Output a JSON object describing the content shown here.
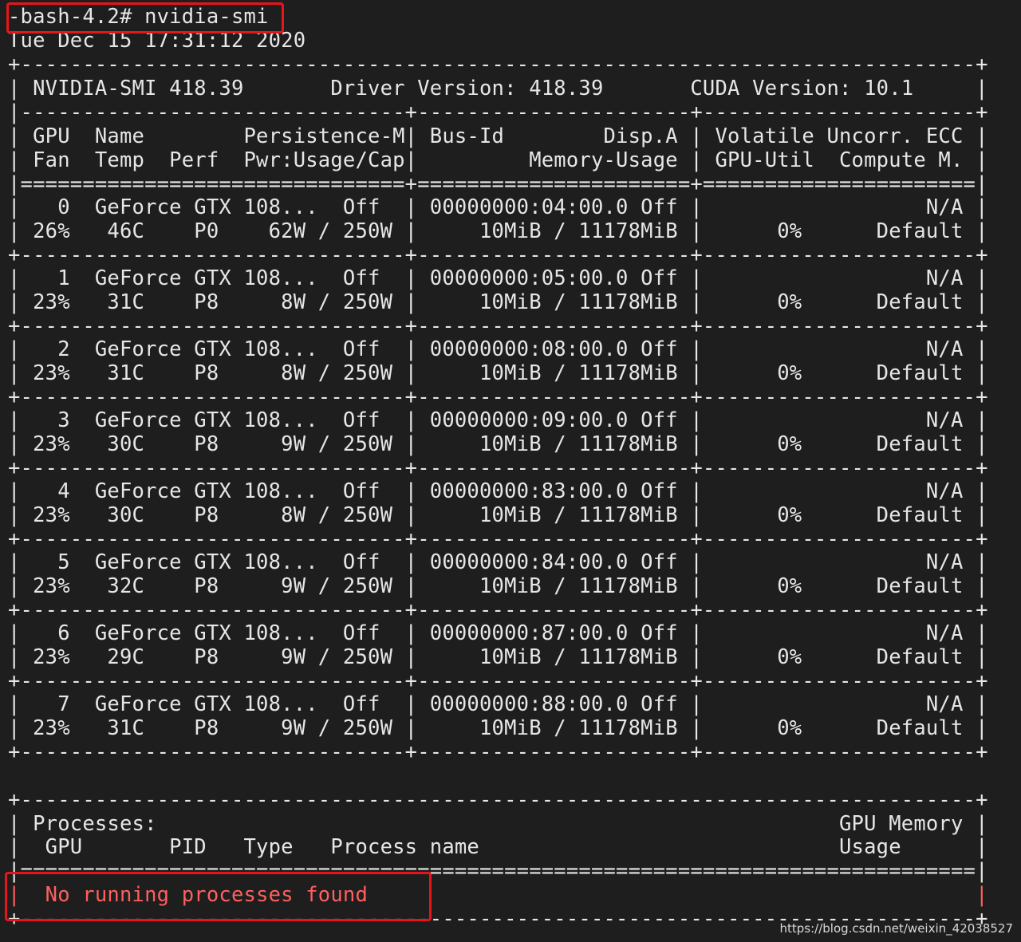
{
  "terminal": {
    "lines": [
      "-bash-4.2# nvidia-smi",
      "Tue Dec 15 17:31:12 2020",
      "+-----------------------------------------------------------------------------+",
      "| NVIDIA-SMI 418.39       Driver Version: 418.39       CUDA Version: 10.1     |",
      "|-------------------------------+----------------------+----------------------+",
      "| GPU  Name        Persistence-M| Bus-Id        Disp.A | Volatile Uncorr. ECC |",
      "| Fan  Temp  Perf  Pwr:Usage/Cap|         Memory-Usage | GPU-Util  Compute M. |",
      "|===============================+======================+======================|",
      "|   0  GeForce GTX 108...  Off  | 00000000:04:00.0 Off |                  N/A |",
      "| 26%   46C    P0    62W / 250W |     10MiB / 11178MiB |      0%      Default |",
      "+-------------------------------+----------------------+----------------------+",
      "|   1  GeForce GTX 108...  Off  | 00000000:05:00.0 Off |                  N/A |",
      "| 23%   31C    P8     8W / 250W |     10MiB / 11178MiB |      0%      Default |",
      "+-------------------------------+----------------------+----------------------+",
      "|   2  GeForce GTX 108...  Off  | 00000000:08:00.0 Off |                  N/A |",
      "| 23%   31C    P8     8W / 250W |     10MiB / 11178MiB |      0%      Default |",
      "+-------------------------------+----------------------+----------------------+",
      "|   3  GeForce GTX 108...  Off  | 00000000:09:00.0 Off |                  N/A |",
      "| 23%   30C    P8     9W / 250W |     10MiB / 11178MiB |      0%      Default |",
      "+-------------------------------+----------------------+----------------------+",
      "|   4  GeForce GTX 108...  Off  | 00000000:83:00.0 Off |                  N/A |",
      "| 23%   30C    P8     8W / 250W |     10MiB / 11178MiB |      0%      Default |",
      "+-------------------------------+----------------------+----------------------+",
      "|   5  GeForce GTX 108...  Off  | 00000000:84:00.0 Off |                  N/A |",
      "| 23%   32C    P8     9W / 250W |     10MiB / 11178MiB |      0%      Default |",
      "+-------------------------------+----------------------+----------------------+",
      "|   6  GeForce GTX 108...  Off  | 00000000:87:00.0 Off |                  N/A |",
      "| 23%   29C    P8     9W / 250W |     10MiB / 11178MiB |      0%      Default |",
      "+-------------------------------+----------------------+----------------------+",
      "|   7  GeForce GTX 108...  Off  | 00000000:88:00.0 Off |                  N/A |",
      "| 23%   31C    P8     9W / 250W |     10MiB / 11178MiB |      0%      Default |",
      "+-------------------------------+----------------------+----------------------+",
      "",
      "+-----------------------------------------------------------------------------+",
      "| Processes:                                                       GPU Memory |",
      "|  GPU       PID   Type   Process name                             Usage      |",
      "|=============================================================================|",
      "|  No running processes found                                                 |",
      "+-----------------------------------------------------------------------------+"
    ]
  },
  "watermark": "https://blog.csdn.net/weixin_42038527",
  "colors": {
    "background": "#1e1e1e",
    "text": "#e6e6e6",
    "highlight_text": "#ff5f5f",
    "highlight_box": "#e8141b"
  }
}
